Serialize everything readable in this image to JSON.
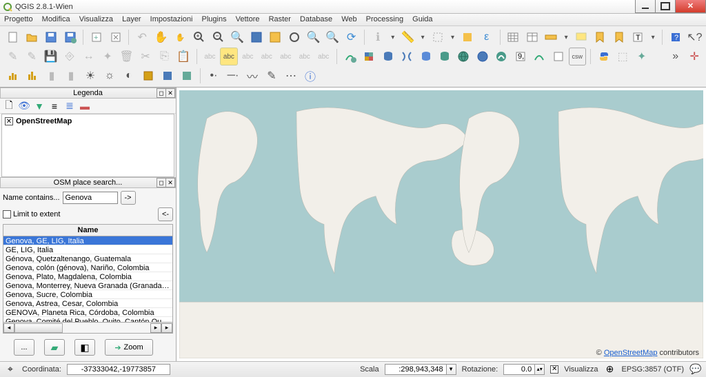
{
  "window": {
    "title": "QGIS 2.8.1-Wien"
  },
  "menu": [
    "Progetto",
    "Modifica",
    "Visualizza",
    "Layer",
    "Impostazioni",
    "Plugins",
    "Vettore",
    "Raster",
    "Database",
    "Web",
    "Processing",
    "Guida"
  ],
  "panels": {
    "legend": {
      "title": "Legenda",
      "layer": "OpenStreetMap"
    },
    "osm": {
      "title": "OSM place search...",
      "name_contains_label": "Name contains...",
      "query": "Genova",
      "limit_label": "Limit to extent",
      "column_header": "Name",
      "results": [
        "Genova, GE, LIG, Italia",
        "GE, LIG, Italia",
        "Génova, Quetzaltenango, Guatemala",
        "Genova, colón (génova), Nariño, Colombia",
        "Genova, Plato, Magdalena, Colombia",
        "Genova, Monterrey, Nueva Granada (Granada), Magdalena, Colombia",
        "Genova, Sucre, Colombia",
        "Genova, Astrea, Cesar, Colombia",
        "GENOVA, Planeta Rica, Córdoba, Colombia",
        "Genova, Comité del Pueblo, Quito, Cantón Quito, Provincia de Pichincha"
      ],
      "zoom_label": "Zoom",
      "go_arrow": "->",
      "back_arrow": "<-",
      "dots": "..."
    }
  },
  "map": {
    "attribution_prefix": "© ",
    "attribution_link": "OpenStreetMap",
    "attribution_suffix": " contributors"
  },
  "status": {
    "coord_label": "Coordinata:",
    "coord_value": "-37333042,-19773857",
    "scale_label": "Scala",
    "scale_value": ":298,943,348",
    "rot_label": "Rotazione:",
    "rot_value": "0.0",
    "render_label": "Visualizza",
    "crs_label": "EPSG:3857 (OTF)"
  }
}
